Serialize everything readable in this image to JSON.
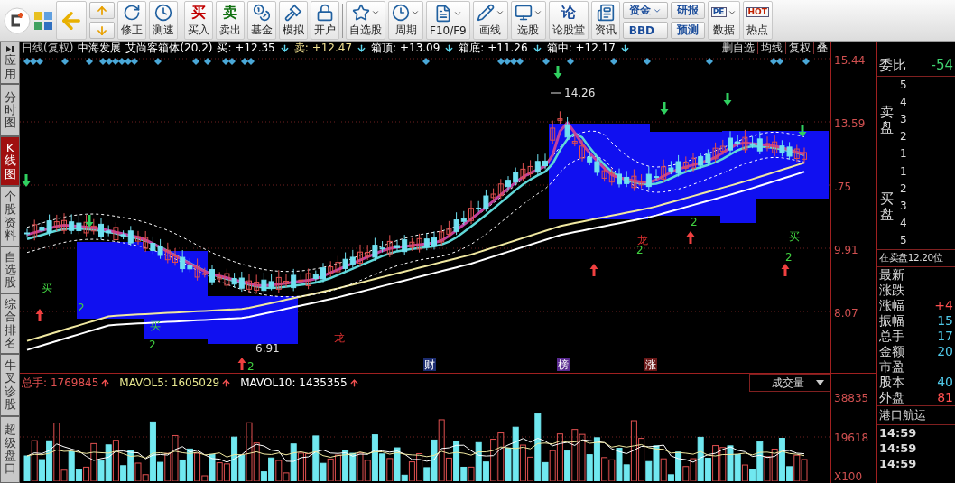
{
  "toolbar": [
    {
      "kind": "back"
    },
    {
      "kind": "updown"
    },
    {
      "kind": "icon",
      "label": "修正",
      "dropdown": false
    },
    {
      "kind": "icon",
      "label": "测速",
      "dropdown": false
    },
    {
      "kind": "sep"
    },
    {
      "kind": "glyph",
      "glyph": "买",
      "label": "买入",
      "dropdown": false
    },
    {
      "kind": "glyph",
      "glyph": "卖",
      "label": "卖出",
      "dropdown": false
    },
    {
      "kind": "icon",
      "label": "基金",
      "dropdown": false
    },
    {
      "kind": "icon",
      "label": "模拟",
      "dropdown": false
    },
    {
      "kind": "icon",
      "label": "开户",
      "dropdown": false
    },
    {
      "kind": "sep"
    },
    {
      "kind": "icon",
      "label": "自选股",
      "dropdown": true
    },
    {
      "kind": "icon",
      "label": "周期",
      "dropdown": true
    },
    {
      "kind": "icon",
      "label": "F10/F9",
      "dropdown": true
    },
    {
      "kind": "icon",
      "label": "画线",
      "dropdown": true
    },
    {
      "kind": "icon",
      "label": "选股",
      "dropdown": true
    },
    {
      "kind": "glyph",
      "glyph": "论",
      "label": "论股堂",
      "dropdown": false
    },
    {
      "kind": "icon",
      "label": "资讯",
      "dropdown": false
    },
    {
      "kind": "stack",
      "buttons": [
        {
          "label": "资金",
          "dropdown": true
        },
        {
          "label": "BBD",
          "dropdown": false
        }
      ]
    },
    {
      "kind": "stack",
      "buttons": [
        {
          "label": "研报",
          "dropdown": false
        },
        {
          "label": "预测",
          "dropdown": false
        }
      ]
    },
    {
      "kind": "glyph",
      "glyph": "PE",
      "label": "数据",
      "dropdown": true
    },
    {
      "kind": "glyph",
      "glyph": "HOT",
      "label": "热点",
      "dropdown": false
    }
  ],
  "side_tabs": [
    {
      "label": "应用",
      "selected": false
    },
    {
      "label": "分时图",
      "selected": false
    },
    {
      "label": "K线图",
      "selected": true
    },
    {
      "label": "个股资料",
      "selected": false
    },
    {
      "label": "自选股",
      "selected": false
    },
    {
      "label": "综合排名",
      "selected": false
    },
    {
      "label": "牛叉诊股",
      "selected": false
    },
    {
      "label": "超级盘口",
      "selected": false
    }
  ],
  "chart_header": {
    "period": "日线(复权)",
    "stock": "中海发展",
    "indicator": "艾尚客箱体(20,2)",
    "values": [
      {
        "label": "买:",
        "value": "+12.35",
        "color": "#ffffff"
      },
      {
        "label": "卖:",
        "value": "+12.47",
        "color": "#f0e090"
      },
      {
        "label": "箱顶:",
        "value": "+13.09",
        "color": "#ffffff"
      },
      {
        "label": "箱底:",
        "value": "+11.26",
        "color": "#ffffff"
      },
      {
        "label": "箱中:",
        "value": "+12.17",
        "color": "#ffffff"
      }
    ],
    "buttons": [
      "删自选",
      "均线",
      "复权",
      "叠"
    ]
  },
  "price_axis": [
    "15.44",
    "13.59",
    ".75",
    "9.91",
    "8.07"
  ],
  "annotations": [
    {
      "text": "14.26",
      "kind": "price"
    },
    {
      "text": "6.91",
      "kind": "price"
    },
    {
      "text": "买",
      "kind": "buy"
    },
    {
      "text": "买",
      "kind": "buy"
    },
    {
      "text": "买",
      "kind": "buy"
    },
    {
      "text": "2",
      "kind": "count"
    },
    {
      "text": "2",
      "kind": "count"
    },
    {
      "text": "2",
      "kind": "count"
    },
    {
      "text": "2",
      "kind": "count"
    },
    {
      "text": "2",
      "kind": "count"
    },
    {
      "text": "2",
      "kind": "count"
    },
    {
      "text": "龙",
      "kind": "dragon"
    },
    {
      "text": "龙",
      "kind": "dragon"
    },
    {
      "text": "财",
      "kind": "tag",
      "color": "#1c2c70"
    },
    {
      "text": "榜",
      "kind": "tag",
      "color": "#5a2a90"
    },
    {
      "text": "涨",
      "kind": "tag",
      "color": "#6a1818"
    }
  ],
  "volume_header": [
    {
      "label": "总手:",
      "value": "1769845",
      "color": "#e05050"
    },
    {
      "label": "MAVOL5:",
      "value": "1605029",
      "color": "#e8e890"
    },
    {
      "label": "MAVOL10:",
      "value": "1435355",
      "color": "#ffffff"
    }
  ],
  "volume_selector": "成交量",
  "volume_axis": [
    "38835",
    "19618",
    "X100"
  ],
  "quote_panel": {
    "ratio": {
      "label": "委比",
      "value": "-54"
    },
    "sell": {
      "label": "卖盘",
      "levels": [
        "5",
        "4",
        "3",
        "2",
        "1"
      ]
    },
    "buy": {
      "label": "买盘",
      "levels": [
        "1",
        "2",
        "3",
        "4",
        "5"
      ]
    },
    "notice": "在卖盘12.20位",
    "stats": [
      {
        "label": "最新"
      },
      {
        "label": "涨跌"
      },
      {
        "label": "涨幅",
        "value": "+4",
        "color": "#ff5050"
      },
      {
        "label": "振幅",
        "value": "15",
        "color": "#50c8e8"
      },
      {
        "label": "总手",
        "value": "17",
        "color": "#50c8e8"
      },
      {
        "label": "金额",
        "value": "20",
        "color": "#50c8e8"
      },
      {
        "label": "市盈"
      },
      {
        "label": "股本",
        "value": "40",
        "color": "#50c8e8"
      },
      {
        "label": "外盘",
        "value": "81",
        "color": "#ff5050"
      }
    ],
    "industry": "港口航运",
    "times": [
      "14:59",
      "14:59",
      "14:59"
    ]
  }
}
